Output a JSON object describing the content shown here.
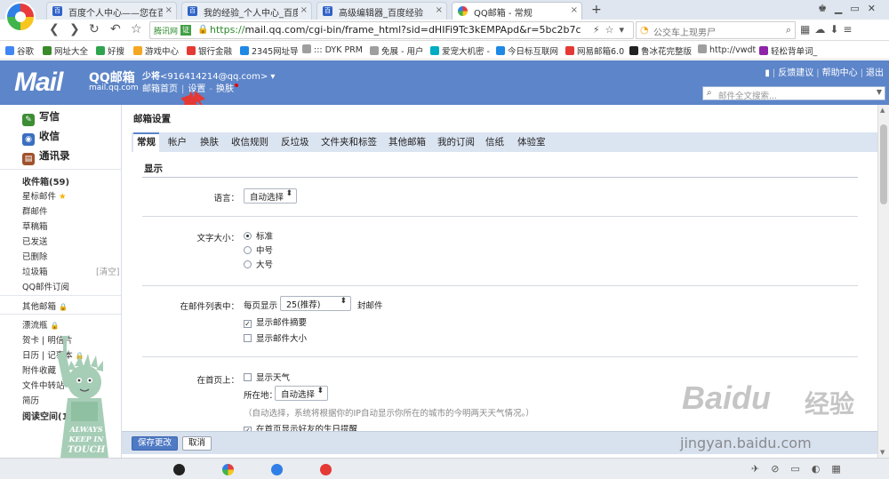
{
  "browser": {
    "tabs": [
      {
        "label": "百度个人中心——您在百度",
        "active": false
      },
      {
        "label": "我的经验_个人中心_百度经验",
        "active": false
      },
      {
        "label": "高级编辑器_百度经验",
        "active": false
      },
      {
        "label": "QQ邮箱 - 常规",
        "active": true
      }
    ],
    "tab_close": "×",
    "new_tab": "+",
    "url_badge": "腾讯网",
    "url_scheme": "https://",
    "url_host": "mail.qq.com",
    "url_path": "/cgi-bin/frame_html?sid=dHIFi9Tc3kEMPApd&r=5bc2b7c",
    "search_placeholder": "公交车上现男尸",
    "bookmarks": [
      {
        "label": "谷歌",
        "color": "#4285f4"
      },
      {
        "label": "网址大全",
        "color": "#3a8a2a"
      },
      {
        "label": "好搜",
        "color": "#2ea44f"
      },
      {
        "label": "游戏中心",
        "color": "#f5a623"
      },
      {
        "label": "银行金融",
        "color": "#e53935"
      },
      {
        "label": "2345网址导",
        "color": "#1e88e5"
      },
      {
        "label": "::: DYK PRM",
        "color": "#9e9e9e"
      },
      {
        "label": "免展 - 用户",
        "color": "#9e9e9e"
      },
      {
        "label": "爱宠大机密 -",
        "color": "#00acc1"
      },
      {
        "label": "今日标互联网",
        "color": "#1e88e5"
      },
      {
        "label": "网易邮箱6.0",
        "color": "#e53935"
      },
      {
        "label": "鲁冰花完整版",
        "color": "#212121"
      },
      {
        "label": "http://vwdt",
        "color": "#9e9e9e"
      },
      {
        "label": "轻松背单词_",
        "color": "#8e24aa"
      }
    ]
  },
  "mail_header": {
    "logo_text": "Mail",
    "logo_cn": "QQ邮箱",
    "logo_domain": "mail.qq.com",
    "user_name": "少将",
    "user_email": "<916414214@qq.com>",
    "links": [
      "邮箱首页",
      "设置",
      "换肤"
    ],
    "top_links": [
      "反馈建议",
      "帮助中心",
      "退出"
    ],
    "search_placeholder": "邮件全文搜索..."
  },
  "sidebar": {
    "actions": [
      {
        "label": "写信",
        "color": "#3d8d34",
        "glyph": "✎"
      },
      {
        "label": "收信",
        "color": "#3b6fc0",
        "glyph": "◉"
      },
      {
        "label": "通讯录",
        "color": "#a0522d",
        "glyph": "▤"
      }
    ],
    "folders": [
      {
        "label": "收件箱(59)",
        "bold": true
      },
      {
        "label": "星标邮件",
        "star": true
      },
      {
        "label": "群邮件"
      },
      {
        "label": "草稿箱"
      },
      {
        "label": "已发送"
      },
      {
        "label": "已删除"
      },
      {
        "label": "垃圾箱"
      },
      {
        "label": "QQ邮件订阅"
      }
    ],
    "clear_label": "[清空]",
    "other_folders": [
      {
        "label": "其他邮箱",
        "lock": true
      },
      {
        "label": "漂流瓶",
        "lock": true
      },
      {
        "label": "贺卡 | 明信片"
      },
      {
        "label": "日历 | 记事本",
        "lock": true
      },
      {
        "label": "附件收藏"
      },
      {
        "label": "文件中转站"
      },
      {
        "label": "简历"
      },
      {
        "label": "阅读空间(180+4)",
        "bold": true
      }
    ],
    "statue_text": [
      "ALWAYS",
      "KEEP IN",
      "TOUCH"
    ]
  },
  "settings": {
    "title": "邮箱设置",
    "tabs": [
      "常规",
      "帐户",
      "换肤",
      "收信规则",
      "反垃圾",
      "文件夹和标签",
      "其他邮箱",
      "我的订阅",
      "信纸",
      "体验室"
    ],
    "section_title": "显示",
    "language_label": "语言：",
    "language_value": "自动选择",
    "font_label": "文字大小：",
    "font_options": [
      "标准",
      "中号",
      "大号"
    ],
    "list_label": "在邮件列表中：",
    "per_page_prefix": "每页显示",
    "per_page_value": "25(推荐)",
    "per_page_suffix": "封邮件",
    "show_summary": "显示邮件摘要",
    "show_size": "显示邮件大小",
    "home_label": "在首页上：",
    "show_weather": "显示天气",
    "location_label": "所在地：",
    "location_value": "自动选择",
    "location_hint": "（自动选择，系统将根据你的IP自动显示你所在的城市的今明两天天气情况。）",
    "birthday_reminder": "在首页显示好友的生日提醒",
    "save_label": "保存更改",
    "cancel_label": "取消"
  },
  "watermark": {
    "word": "Baidu",
    "cn": "经验",
    "domain": "jingyan.baidu.com"
  },
  "colors": {
    "header_blue": "#5d85c9",
    "tab_strip": "#dbe4f1",
    "annotation_red": "#e53935"
  }
}
